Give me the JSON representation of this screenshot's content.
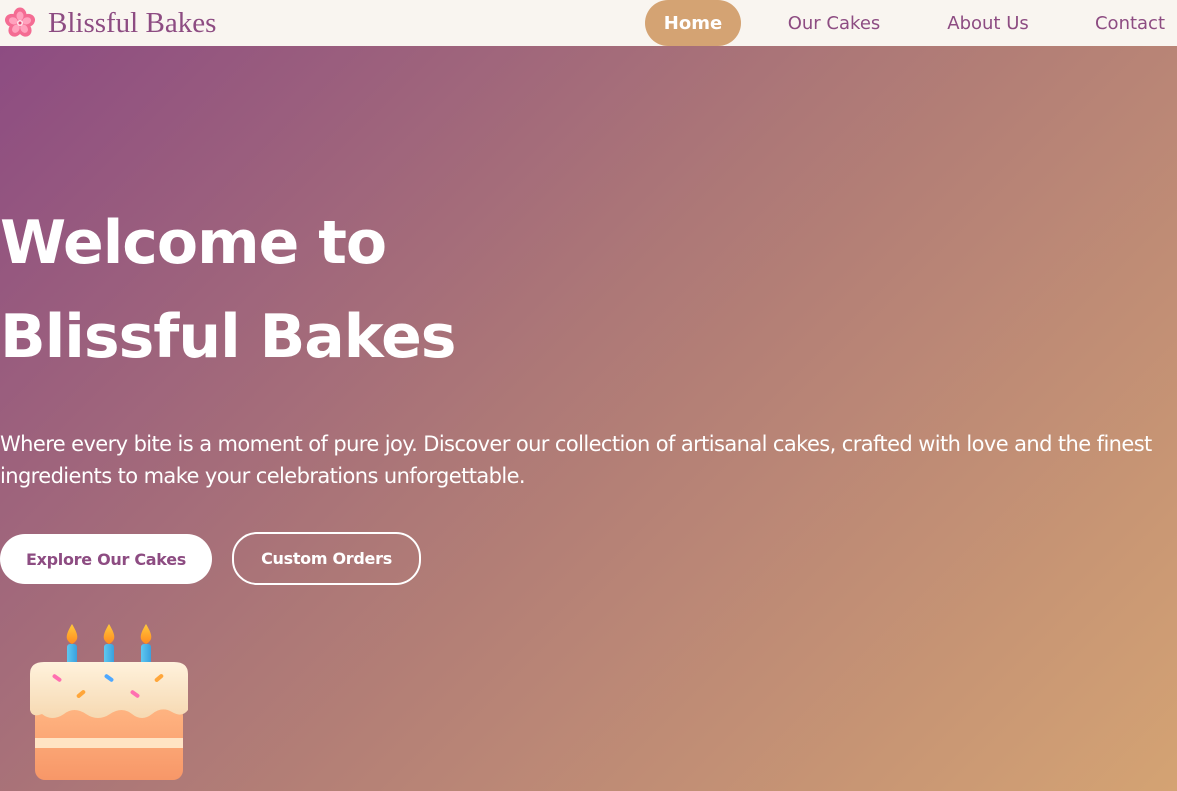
{
  "colors": {
    "primary": "#8d4c82",
    "accent": "#d4a373",
    "nav_background": "#f9f5f0",
    "button_text_light": "#ffffff"
  },
  "header": {
    "brand_icon": "cherry-blossom-icon",
    "brand_name": "Blissful Bakes",
    "nav": {
      "home": "Home",
      "cakes": "Our Cakes",
      "about": "About Us",
      "contact": "Contact"
    },
    "active_nav": "Home"
  },
  "hero": {
    "title_line1": "Welcome to",
    "title_line2": "Blissful Bakes",
    "description": "Where every bite is a moment of pure joy. Discover our collection of artisanal cakes, crafted with love and the finest ingredients to make your celebrations unforgettable.",
    "primary_button": "Explore Our Cakes",
    "secondary_button": "Custom Orders",
    "illustration": "birthday-cake-icon"
  }
}
